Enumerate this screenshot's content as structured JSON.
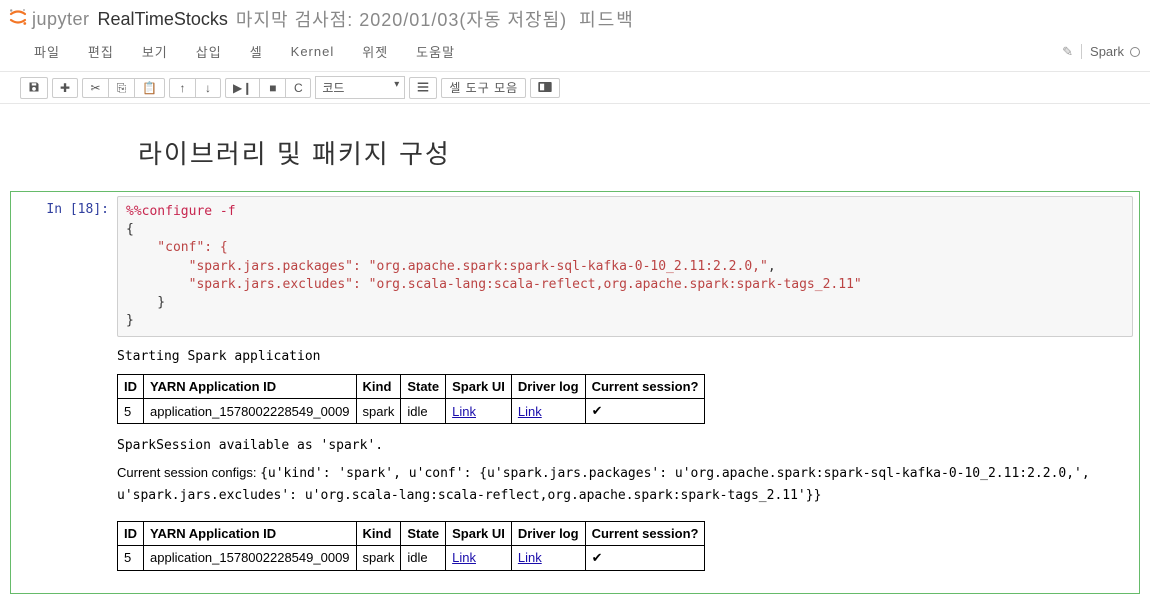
{
  "header": {
    "logo_text": "jupyter",
    "notebook_name": "RealTimeStocks",
    "checkpoint": "마지막 검사점: 2020/01/03(자동 저장됨)",
    "feedback": "피드백"
  },
  "menubar": {
    "file": "파일",
    "edit": "편집",
    "view": "보기",
    "insert": "삽입",
    "cell": "셀",
    "kernel": "Kernel",
    "widgets": "위젯",
    "help": "도움말",
    "kernel_name": "Spark"
  },
  "toolbar": {
    "celltype": "코드",
    "cmd_palette": "셀 도구 모음"
  },
  "cell": {
    "prompt": "In [18]:",
    "heading": "라이브러리 및 패키지 구성",
    "code": {
      "l1": "%%configure -f",
      "l2": "{",
      "l3": "    \"conf\": {",
      "l4a": "        \"spark.jars.packages\": ",
      "l4b": "\"org.apache.spark:spark-sql-kafka-0-10_2.11:2.2.0,\"",
      "l4c": ",",
      "l5a": "        \"spark.jars.excludes\": ",
      "l5b": "\"org.scala-lang:scala-reflect,org.apache.spark:spark-tags_2.11\"",
      "l6": "    }",
      "l7": "}"
    },
    "out": {
      "starting": "Starting Spark application",
      "session_available": "SparkSession available as 'spark'.",
      "configs_label": "Current session configs: ",
      "configs_value": "{u'kind': 'spark', u'conf': {u'spark.jars.packages': u'org.apache.spark:spark-sql-kafka-0-10_2.11:2.2.0,', u'spark.jars.excludes': u'org.scala-lang:scala-reflect,org.apache.spark:spark-tags_2.11'}}"
    },
    "table": {
      "h_id": "ID",
      "h_yarn": "YARN Application ID",
      "h_kind": "Kind",
      "h_state": "State",
      "h_sparkui": "Spark UI",
      "h_driver": "Driver log",
      "h_current": "Current session?",
      "r1_id": "5",
      "r1_yarn": "application_1578002228549_0009",
      "r1_kind": "spark",
      "r1_state": "idle",
      "r1_link": "Link",
      "r1_check": "✔",
      "r2_id": "5"
    }
  }
}
